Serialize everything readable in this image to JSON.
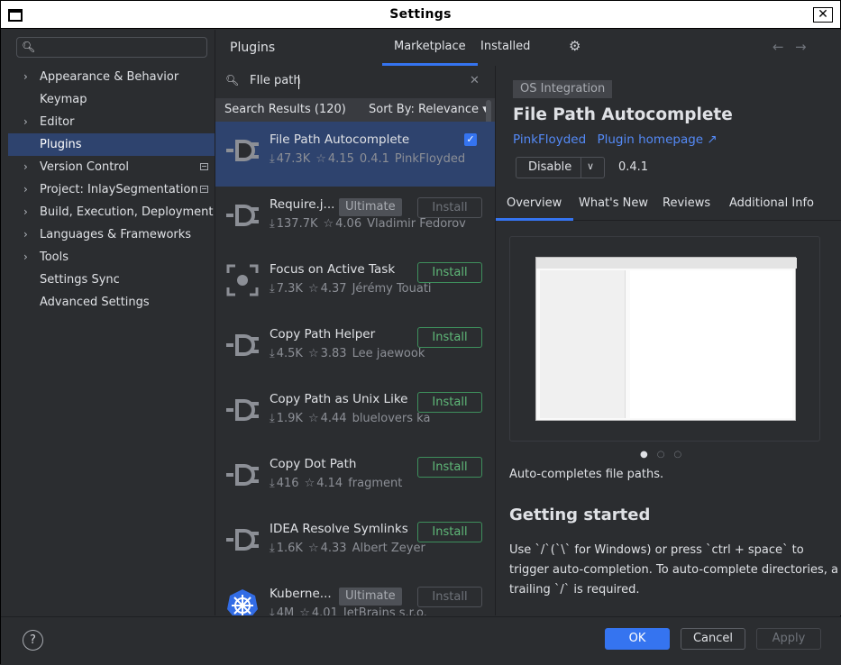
{
  "window": {
    "title": "Settings",
    "close": "✕"
  },
  "left": {
    "search_placeholder": "",
    "items": [
      {
        "label": "Appearance & Behavior",
        "chevron": true
      },
      {
        "label": "Keymap",
        "chevron": false
      },
      {
        "label": "Editor",
        "chevron": true
      },
      {
        "label": "Plugins",
        "chevron": false,
        "selected": true
      },
      {
        "label": "Version Control",
        "chevron": true,
        "mark": true
      },
      {
        "label": "Project: InlaySegmentation",
        "chevron": true,
        "mark": true
      },
      {
        "label": "Build, Execution, Deployment",
        "chevron": true
      },
      {
        "label": "Languages & Frameworks",
        "chevron": true
      },
      {
        "label": "Tools",
        "chevron": true
      },
      {
        "label": "Settings Sync",
        "chevron": false
      },
      {
        "label": "Advanced Settings",
        "chevron": false
      }
    ]
  },
  "header": {
    "title": "Plugins",
    "tab_marketplace": "Marketplace",
    "tab_installed": "Installed"
  },
  "search": {
    "value": "FIle path"
  },
  "results": {
    "label": "Search Results (120)",
    "sort": "Sort By: Relevance ▾"
  },
  "plugins": [
    {
      "name": "File Path Autocomplete",
      "downloads": "47.3K",
      "rating": "4.15",
      "version": "0.4.1",
      "vendor": "PinkFloyded",
      "selected": true,
      "installed": true
    },
    {
      "name": "Require.j...",
      "ultimate": "Ultimate",
      "downloads": "137.7K",
      "rating": "4.06",
      "vendor": "Vladimir Fedorov",
      "button": "Install",
      "disabled": true
    },
    {
      "name": "Focus on Active Task",
      "downloads": "7.3K",
      "rating": "4.37",
      "vendor": "Jérémy Touati",
      "button": "Install",
      "focus": true
    },
    {
      "name": "Copy Path Helper",
      "downloads": "4.5K",
      "rating": "3.83",
      "vendor": "Lee jaewook",
      "button": "Install"
    },
    {
      "name": "Copy Path as Unix Like",
      "downloads": "1.9K",
      "rating": "4.44",
      "vendor": "bluelovers ka",
      "button": "Install"
    },
    {
      "name": "Copy Dot Path",
      "downloads": "416",
      "rating": "4.14",
      "vendor": "fragment",
      "button": "Install"
    },
    {
      "name": "IDEA Resolve Symlinks",
      "downloads": "1.6K",
      "rating": "4.33",
      "vendor": "Albert Zeyer",
      "button": "Install"
    },
    {
      "name": "Kuberne...",
      "ultimate": "Ultimate",
      "downloads": "4M",
      "rating": "4.01",
      "vendor": "JetBrains s.r.o.",
      "button": "Install",
      "disabled": true,
      "kube": true
    }
  ],
  "detail": {
    "tag": "OS Integration",
    "title": "File Path Autocomplete",
    "vendor": "PinkFloyded",
    "homepage": "Plugin homepage ↗",
    "disable": "Disable",
    "version": "0.4.1",
    "tabs": [
      "Overview",
      "What's New",
      "Reviews",
      "Additional Info"
    ],
    "description": "Auto-completes file paths.",
    "heading": "Getting started",
    "paragraph": "Use `/`(`\\` for Windows) or press `ctrl + space` to trigger auto-completion. To auto-complete directories, a trailing `/` is required."
  },
  "footer": {
    "ok": "OK",
    "cancel": "Cancel",
    "apply": "Apply",
    "help": "?"
  },
  "colors": {
    "accent": "#3574f0",
    "selection": "#2e436e",
    "install_green": "#5fb878",
    "link": "#548af7"
  }
}
